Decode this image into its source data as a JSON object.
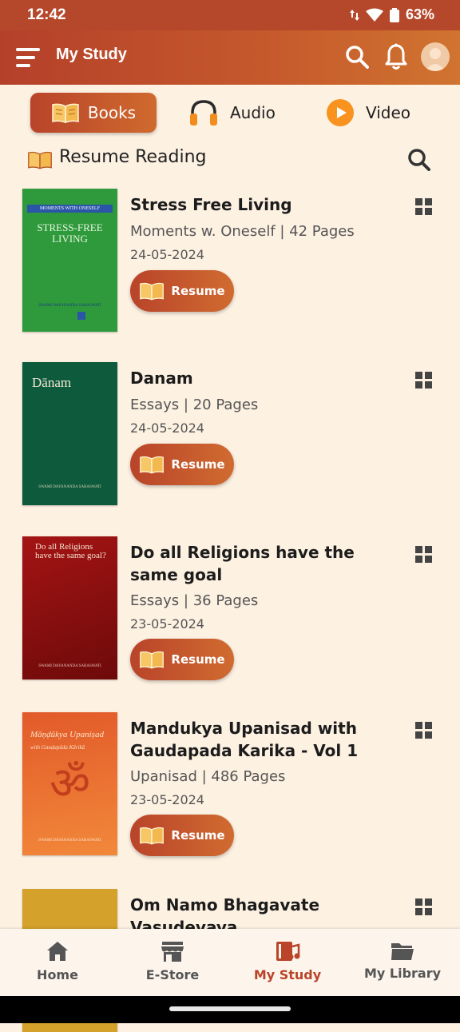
{
  "status_bar": {
    "time": "12:42",
    "battery": "63%"
  },
  "app_bar": {
    "title": "My Study"
  },
  "tabs": [
    {
      "label": "Books",
      "active": true
    },
    {
      "label": "Audio",
      "active": false
    },
    {
      "label": "Video",
      "active": false
    }
  ],
  "section": {
    "title": "Resume Reading"
  },
  "books": [
    {
      "title": "Stress Free Living",
      "meta": "Moments w. Oneself | 42 Pages",
      "date": "24-05-2024",
      "resume_label": "Resume",
      "cover": {
        "bg": "#2e9a3c",
        "series": "MOMENTS WITH ONESELF",
        "title": "STRESS-FREE LIVING",
        "author": "SWAMI DAYANANDA SARASWATI"
      }
    },
    {
      "title": "Danam",
      "meta": "Essays | 20 Pages",
      "date": "24-05-2024",
      "resume_label": "Resume",
      "cover": {
        "bg": "#0e5a3c",
        "title": "Dānam",
        "author": "SWAMI DAYANANDA SARASWATI"
      }
    },
    {
      "title": "Do all Religions have the same goal",
      "meta": "Essays | 36 Pages",
      "date": "23-05-2024",
      "resume_label": "Resume",
      "cover": {
        "bg": "#8e1010",
        "title": "Do all Religions have the same goal?",
        "author": "SWAMI DAYANANDA SARASWATI"
      }
    },
    {
      "title": "Mandukya Upanisad with Gaudapada Karika - Vol 1",
      "meta": "Upanisad | 486 Pages",
      "date": "23-05-2024",
      "resume_label": "Resume",
      "cover": {
        "bg": "#e4612e",
        "title": "Māṇḍūkya Upaniṣad",
        "subtitle": "with Gauḍapāda Kārikā",
        "symbol": "ॐ",
        "author": "SWAMI DAYANANDA SARASWATI"
      }
    },
    {
      "title": "Om Namo Bhagavate Vasudevaya",
      "cover": {
        "bg": "#d4a22a"
      }
    }
  ],
  "bottom_nav": [
    {
      "label": "Home",
      "icon": "home-icon",
      "active": false
    },
    {
      "label": "E-Store",
      "icon": "store-icon",
      "active": false
    },
    {
      "label": "My Study",
      "icon": "study-icon",
      "active": true
    },
    {
      "label": "My Library",
      "icon": "folder-icon",
      "active": false
    }
  ],
  "colors": {
    "accent": "#b9442a",
    "background": "#fdf1e2"
  }
}
